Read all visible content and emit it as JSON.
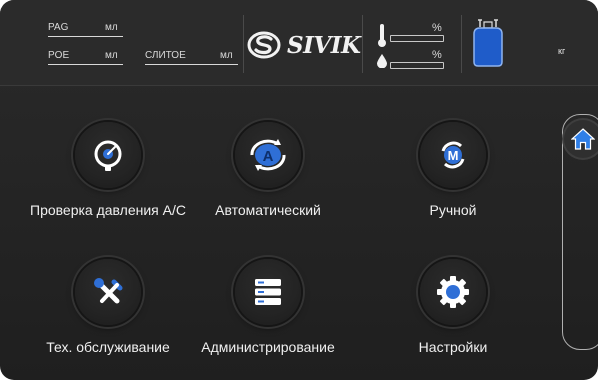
{
  "status": {
    "pag_label": "PAG",
    "poe_label": "POE",
    "uv_label": "СЛИТОЕ",
    "ml_unit": "мл",
    "percent": "%",
    "kg_unit": "кг",
    "brand": "SIVIK"
  },
  "menu": {
    "pressure_check": "Проверка давления А/С",
    "automatic": "Автоматический",
    "manual": "Ручной",
    "service": "Тех. обслуживание",
    "admin": "Администрирование",
    "settings": "Настройки"
  },
  "colors": {
    "accent_blue": "#2f6fd6",
    "background": "#232323",
    "text": "#f0f0f0"
  },
  "icons": {
    "pressure_check": "gauge-icon",
    "automatic": "auto-cycle-icon",
    "manual": "manual-m-icon",
    "service": "wrench-icon",
    "admin": "server-list-icon",
    "settings": "gear-icon",
    "home": "home-icon",
    "tank": "refrigerant-tank-icon"
  }
}
